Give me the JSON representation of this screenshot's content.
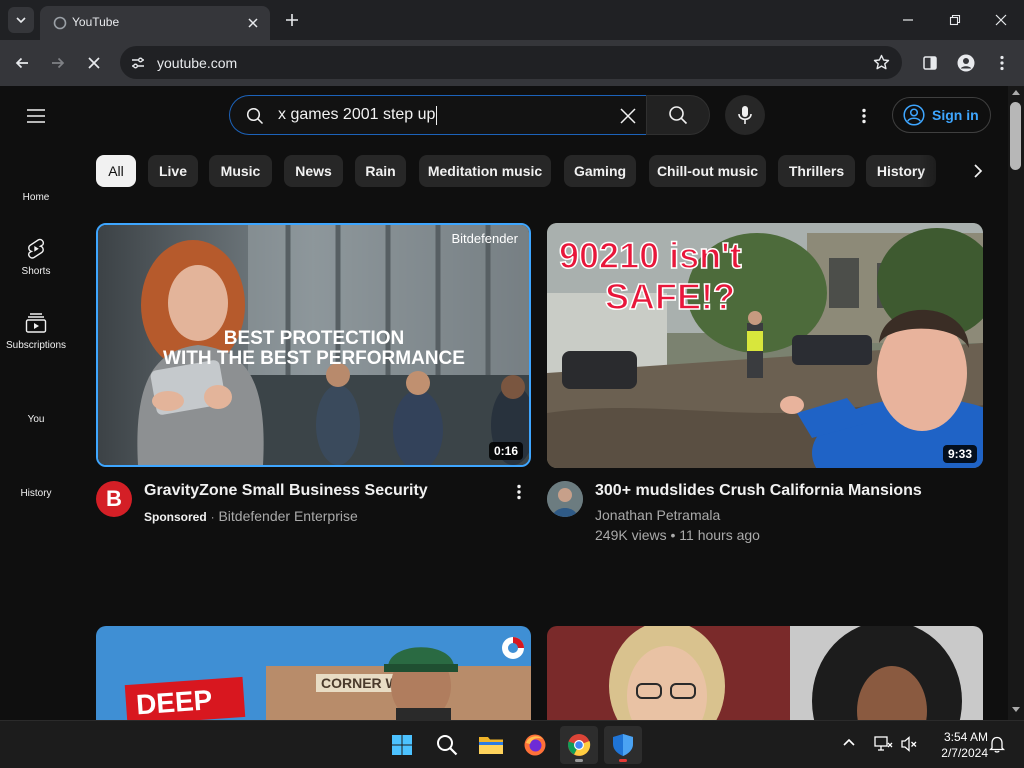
{
  "browser": {
    "tab_title": "YouTube",
    "url": "youtube.com"
  },
  "header": {
    "search_query": "x games 2001 step up",
    "sign_in": "Sign in"
  },
  "chips": [
    "All",
    "Live",
    "Music",
    "News",
    "Rain",
    "Meditation music",
    "Gaming",
    "Chill-out music",
    "Thrillers",
    "History"
  ],
  "guide": [
    {
      "label": "Home",
      "icon": "home-icon"
    },
    {
      "label": "Shorts",
      "icon": "shorts-icon"
    },
    {
      "label": "Subscriptions",
      "icon": "subscriptions-icon"
    },
    {
      "label": "You",
      "icon": "you-icon"
    },
    {
      "label": "History",
      "icon": "history-icon"
    }
  ],
  "videos": [
    {
      "title": "GravityZone Small Business Security",
      "sponsored": "Sponsored",
      "channel": "Bitdefender Enterprise",
      "duration": "0:16",
      "brand": "Bitdefender",
      "overlay": [
        "BEST PROTECTION",
        "WITH THE BEST PERFORMANCE"
      ],
      "avatar_letter": "B"
    },
    {
      "title": "300+ mudslides Crush California Mansions",
      "channel": "Jonathan Petramala",
      "stats": "249K views • 11 hours ago",
      "duration": "9:33",
      "overlay": [
        "90210 isn't",
        "SAFE!?"
      ]
    },
    {
      "overlay": [
        "DEEP"
      ],
      "sign_text": "CORNER W"
    },
    {}
  ],
  "taskbar": {
    "time": "3:54 AM",
    "date": "2/7/2024"
  },
  "colors": {
    "yt_background": "#0f0f0f",
    "accent_blue": "#3ea6ff",
    "chip_bg": "#272727",
    "youtube_red": "#ff0000",
    "bitdefender_red": "#d41f26"
  }
}
